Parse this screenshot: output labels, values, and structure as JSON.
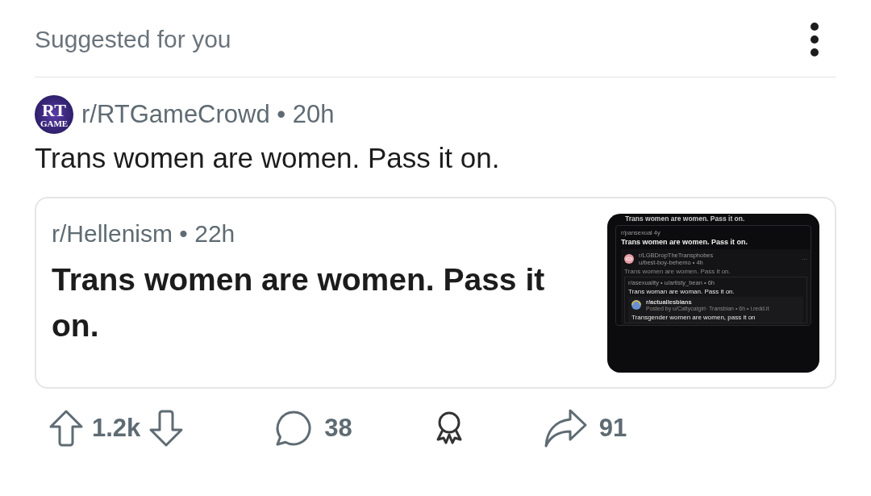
{
  "header": {
    "title": "Suggested for you"
  },
  "post": {
    "avatar": {
      "line_1": "RT",
      "line_2": "GAME"
    },
    "meta": "r/RTGameCrowd • 20h",
    "title": "Trans women are women. Pass it on."
  },
  "crosspost": {
    "meta": "r/Hellenism • 22h",
    "title": "Trans women are women. Pass it on.",
    "thumbnail": {
      "top_title": "Trans women are women. Pass it on.",
      "meta": "r/pansexual  4y",
      "title": "Trans women are women. Pass it on.",
      "nested": {
        "subreddit": "r/LGBDropTheTransphobes",
        "user": "u/best-boy-behemo • 4h",
        "more": "···",
        "title": "Trans women are women. Pass it on.",
        "quote": {
          "meta": "r/asexuality • u/artisty_bean • 6h",
          "title": "Trans woman are woman. Pass it on.",
          "inner": {
            "subreddit": "r/actuallesbians",
            "byline": "Posted by u/Cattycatgirl· Transbian • 6h • i.redd.it",
            "title": "Transgender women are women, pass it on"
          }
        }
      }
    }
  },
  "actions": {
    "score": "1.2k",
    "comments": "38",
    "shares": "91"
  }
}
